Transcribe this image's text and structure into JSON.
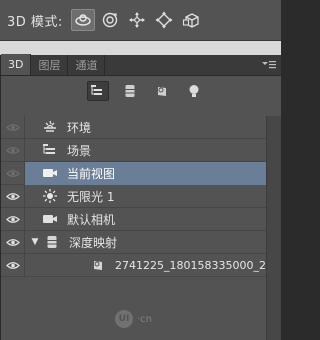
{
  "options_bar": {
    "mode_label": "3D 模式:",
    "tools": [
      {
        "icon": "rotate-3d-icon",
        "selected": true
      },
      {
        "icon": "roll-3d-icon",
        "selected": false
      },
      {
        "icon": "drag-3d-icon",
        "selected": false
      },
      {
        "icon": "slide-3d-icon",
        "selected": false
      },
      {
        "icon": "scale-3d-icon",
        "selected": false
      }
    ]
  },
  "panel": {
    "tabs": [
      {
        "label": "3D",
        "active": true
      },
      {
        "label": "图层",
        "active": false
      },
      {
        "label": "通道",
        "active": false
      }
    ],
    "filters": [
      {
        "icon": "scene-filter-icon",
        "selected": true
      },
      {
        "icon": "mesh-filter-icon",
        "selected": false
      },
      {
        "icon": "material-filter-icon",
        "selected": false
      },
      {
        "icon": "light-filter-icon",
        "selected": false
      }
    ],
    "layers": [
      {
        "label": "环境",
        "icon": "environment-icon",
        "visible": true
      },
      {
        "label": "场景",
        "icon": "scene-icon",
        "visible": true
      },
      {
        "label": "当前视图",
        "icon": "camera-icon",
        "visible": true,
        "selected": true
      },
      {
        "label": "无限光 1",
        "icon": "infinite-light-icon",
        "visible": true
      },
      {
        "label": "默认相机",
        "icon": "camera-icon",
        "visible": true
      },
      {
        "label": "深度映射",
        "icon": "mesh-icon",
        "visible": true,
        "expanded": true
      },
      {
        "label": "2741225_180158335000_2 ...",
        "icon": "material-icon",
        "visible": true,
        "indent": true
      }
    ]
  },
  "watermark": {
    "logo": "UI",
    "text": "·cn"
  },
  "colors": {
    "selection": "#6a7e98",
    "panel_bg": "#535353",
    "tab_bar": "#3a3a3a"
  }
}
